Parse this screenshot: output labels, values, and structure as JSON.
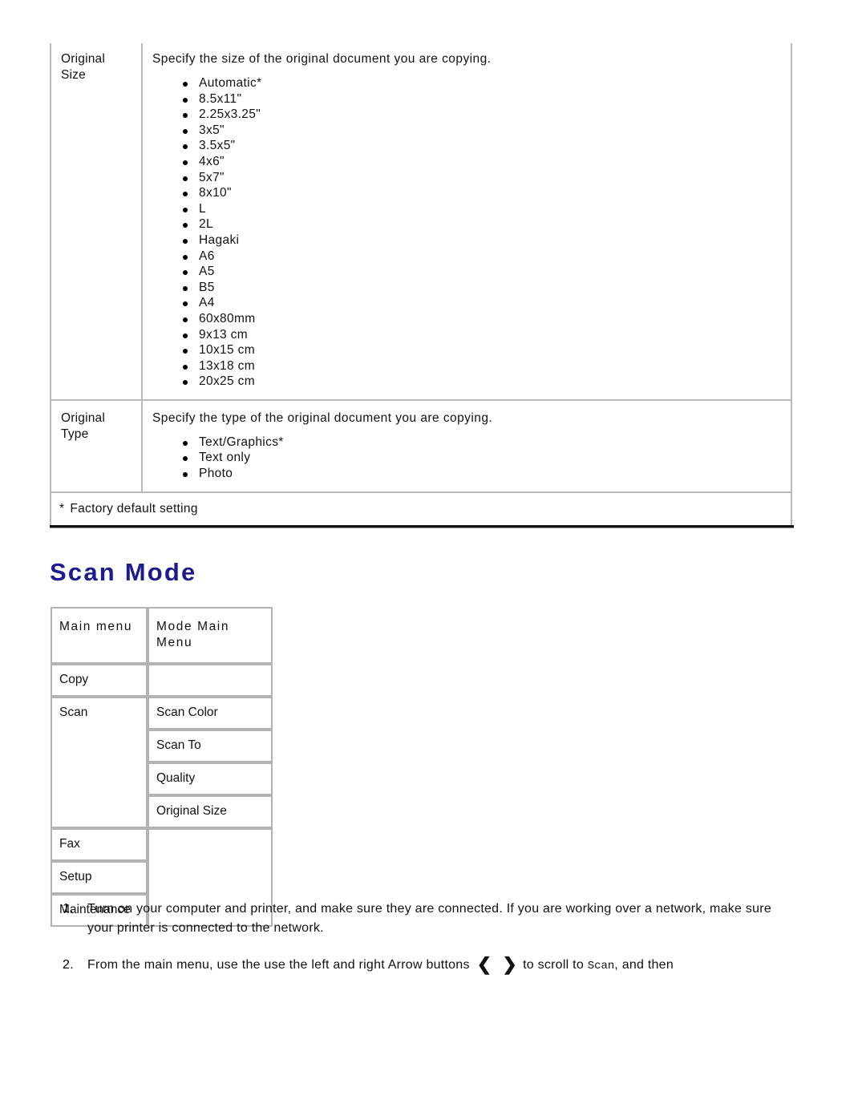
{
  "settings_table": {
    "rows": [
      {
        "label": "Original Size",
        "description": "Specify the size of the original document you are copying.",
        "options": [
          "Automatic*",
          "8.5x11\"",
          "2.25x3.25\"",
          "3x5\"",
          "3.5x5\"",
          "4x6\"",
          "5x7\"",
          "8x10\"",
          "L",
          "2L",
          "Hagaki",
          "A6",
          "A5",
          "B5",
          "A4",
          "60x80mm",
          "9x13 cm",
          "10x15 cm",
          "13x18 cm",
          "20x25 cm"
        ]
      },
      {
        "label": "Original Type",
        "description": "Specify the type of the original document you are copying.",
        "options": [
          "Text/Graphics*",
          "Text only",
          "Photo"
        ]
      }
    ],
    "footnote_marker": "*",
    "footnote_text": "Factory default setting"
  },
  "section": {
    "heading": "Scan Mode",
    "heading_color": "#1c1c8f"
  },
  "menu_table": {
    "headers": {
      "col_a": "Main menu",
      "col_b": "Mode Main Menu"
    },
    "rows": [
      {
        "main": "Copy",
        "sub": []
      },
      {
        "main": "Scan",
        "sub": [
          "Scan Color",
          "Scan To",
          "Quality",
          "Original Size"
        ]
      },
      {
        "main": "Fax",
        "sub": []
      },
      {
        "main": "Setup",
        "sub": []
      },
      {
        "main": "Maintenance",
        "sub": []
      }
    ]
  },
  "steps": [
    {
      "number": "1.",
      "text": "Turn on your computer and printer, and make sure they are connected. If you are working over a network, make sure your printer is connected to the network."
    },
    {
      "number": "2.",
      "text_before": "From the main menu, use the use the left and right Arrow buttons",
      "icon_left": "chevron-left-icon",
      "icon_right": "chevron-right-icon",
      "glyph_left": "❮",
      "glyph_right": "❯",
      "text_after_1": "to scroll to",
      "mono_term": "Scan",
      "text_after_2": ", and then"
    }
  ]
}
